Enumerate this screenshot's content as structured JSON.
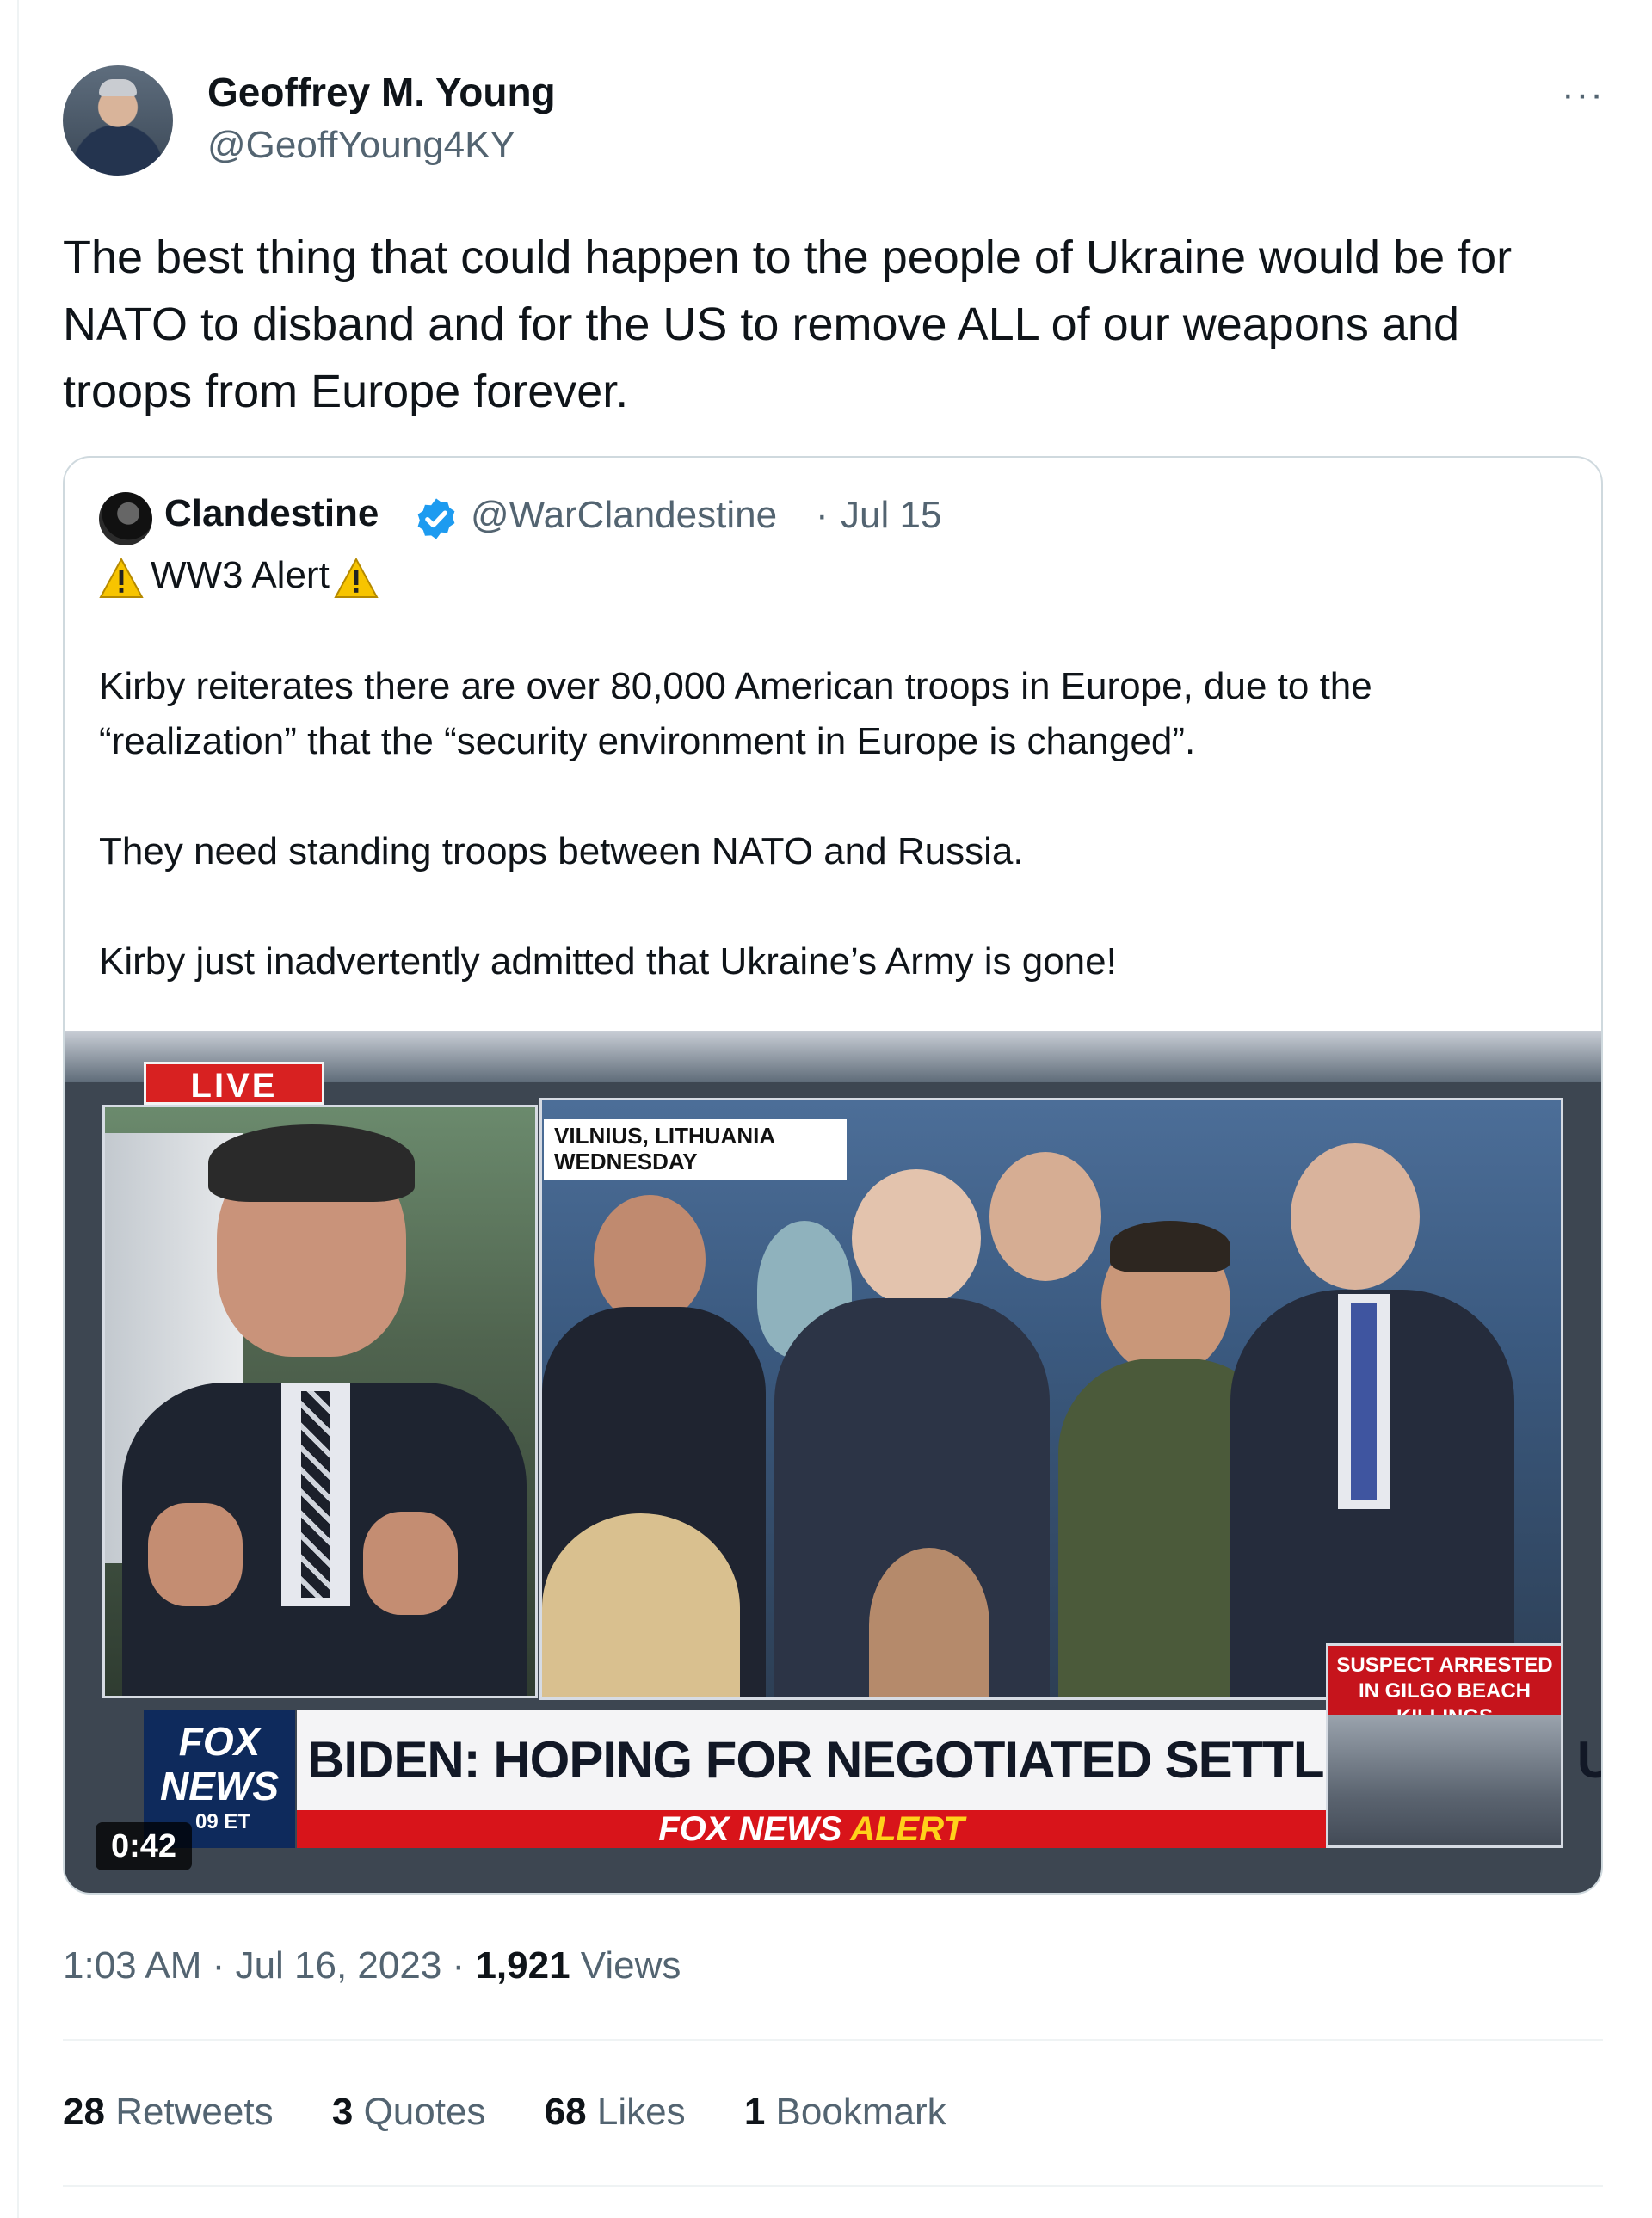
{
  "author": {
    "display_name": "Geoffrey M. Young",
    "handle": "@GeoffYoung4KY"
  },
  "more_menu_label": "···",
  "tweet_text": "The best thing that could happen to the people of Ukraine would be for NATO to disband and for the US to remove ALL of our weapons and troops from Europe forever.",
  "quoted": {
    "display_name": "Clandestine",
    "handle": "@WarClandestine",
    "separator": "·",
    "date": "Jul 15",
    "alert_text": "WW3 Alert",
    "paragraph_1": "Kirby reiterates there are over 80,000 American troops in Europe, due to the “realization” that the “security environment in Europe is changed”.",
    "paragraph_2": "They need standing troops between NATO and Russia.",
    "paragraph_3": "Kirby just inadvertently admitted that Ukraine’s Army is gone!",
    "media": {
      "live_label": "LIVE",
      "location_line1": "VILNIUS, LITHUANIA",
      "location_line2": "WEDNESDAY",
      "logo_line1": "FOX",
      "logo_line2": "NEWS",
      "logo_time": "09 ET",
      "headline": "BIDEN: HOPING FOR NEGOTIATED SETTLEMENT IN UKRAINE",
      "alert_bar_prefix": "FOX NEWS",
      "alert_bar_word": "ALERT",
      "side_headline": "SUSPECT ARRESTED IN GILGO BEACH KILLINGS",
      "duration": "0:42"
    }
  },
  "meta": {
    "time": "1:03 AM",
    "date": "Jul 16, 2023",
    "separator": "·",
    "views_count": "1,921",
    "views_label": "Views"
  },
  "stats": [
    {
      "count": "28",
      "label": "Retweets"
    },
    {
      "count": "3",
      "label": "Quotes"
    },
    {
      "count": "68",
      "label": "Likes"
    },
    {
      "count": "1",
      "label": "Bookmark"
    }
  ],
  "colors": {
    "text": "#0f1419",
    "secondary": "#536471",
    "border": "#cfd9de",
    "verified": "#1d9bf0",
    "fox_red": "#d8141a",
    "fox_blue": "#0e2a5c"
  }
}
